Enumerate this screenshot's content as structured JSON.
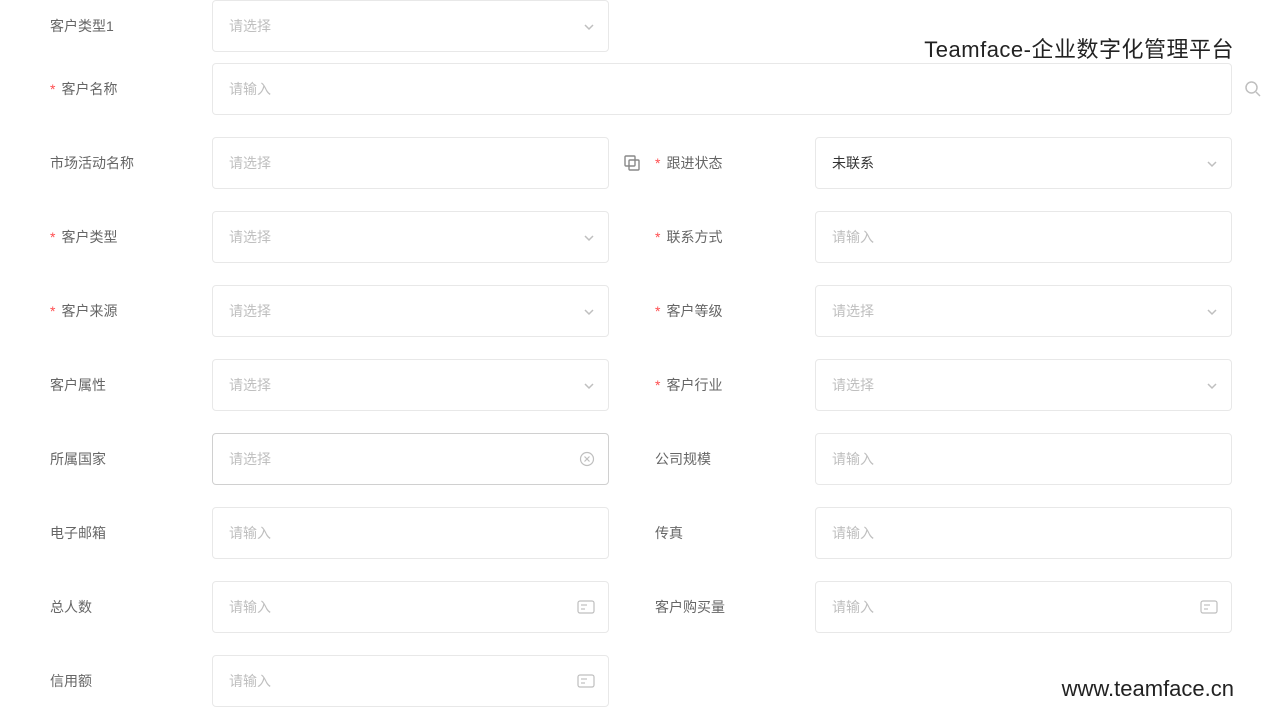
{
  "branding": {
    "title": "Teamface-企业数字化管理平台",
    "url": "www.teamface.cn"
  },
  "placeholders": {
    "select": "请选择",
    "input": "请输入"
  },
  "fields": {
    "customer_type_1": {
      "label": "客户类型1"
    },
    "customer_name": {
      "label": "客户名称",
      "required": true
    },
    "campaign_name": {
      "label": "市场活动名称"
    },
    "follow_status": {
      "label": "跟进状态",
      "required": true,
      "value": "未联系"
    },
    "customer_type": {
      "label": "客户类型",
      "required": true
    },
    "contact_method": {
      "label": "联系方式",
      "required": true
    },
    "customer_source": {
      "label": "客户来源",
      "required": true
    },
    "customer_level": {
      "label": "客户等级",
      "required": true
    },
    "customer_attribute": {
      "label": "客户属性"
    },
    "customer_industry": {
      "label": "客户行业",
      "required": true
    },
    "country": {
      "label": "所属国家"
    },
    "company_size": {
      "label": "公司规模"
    },
    "email": {
      "label": "电子邮箱"
    },
    "fax": {
      "label": "传真"
    },
    "total_people": {
      "label": "总人数"
    },
    "purchase_amount": {
      "label": "客户购买量"
    },
    "credit_limit": {
      "label": "信用额"
    }
  }
}
